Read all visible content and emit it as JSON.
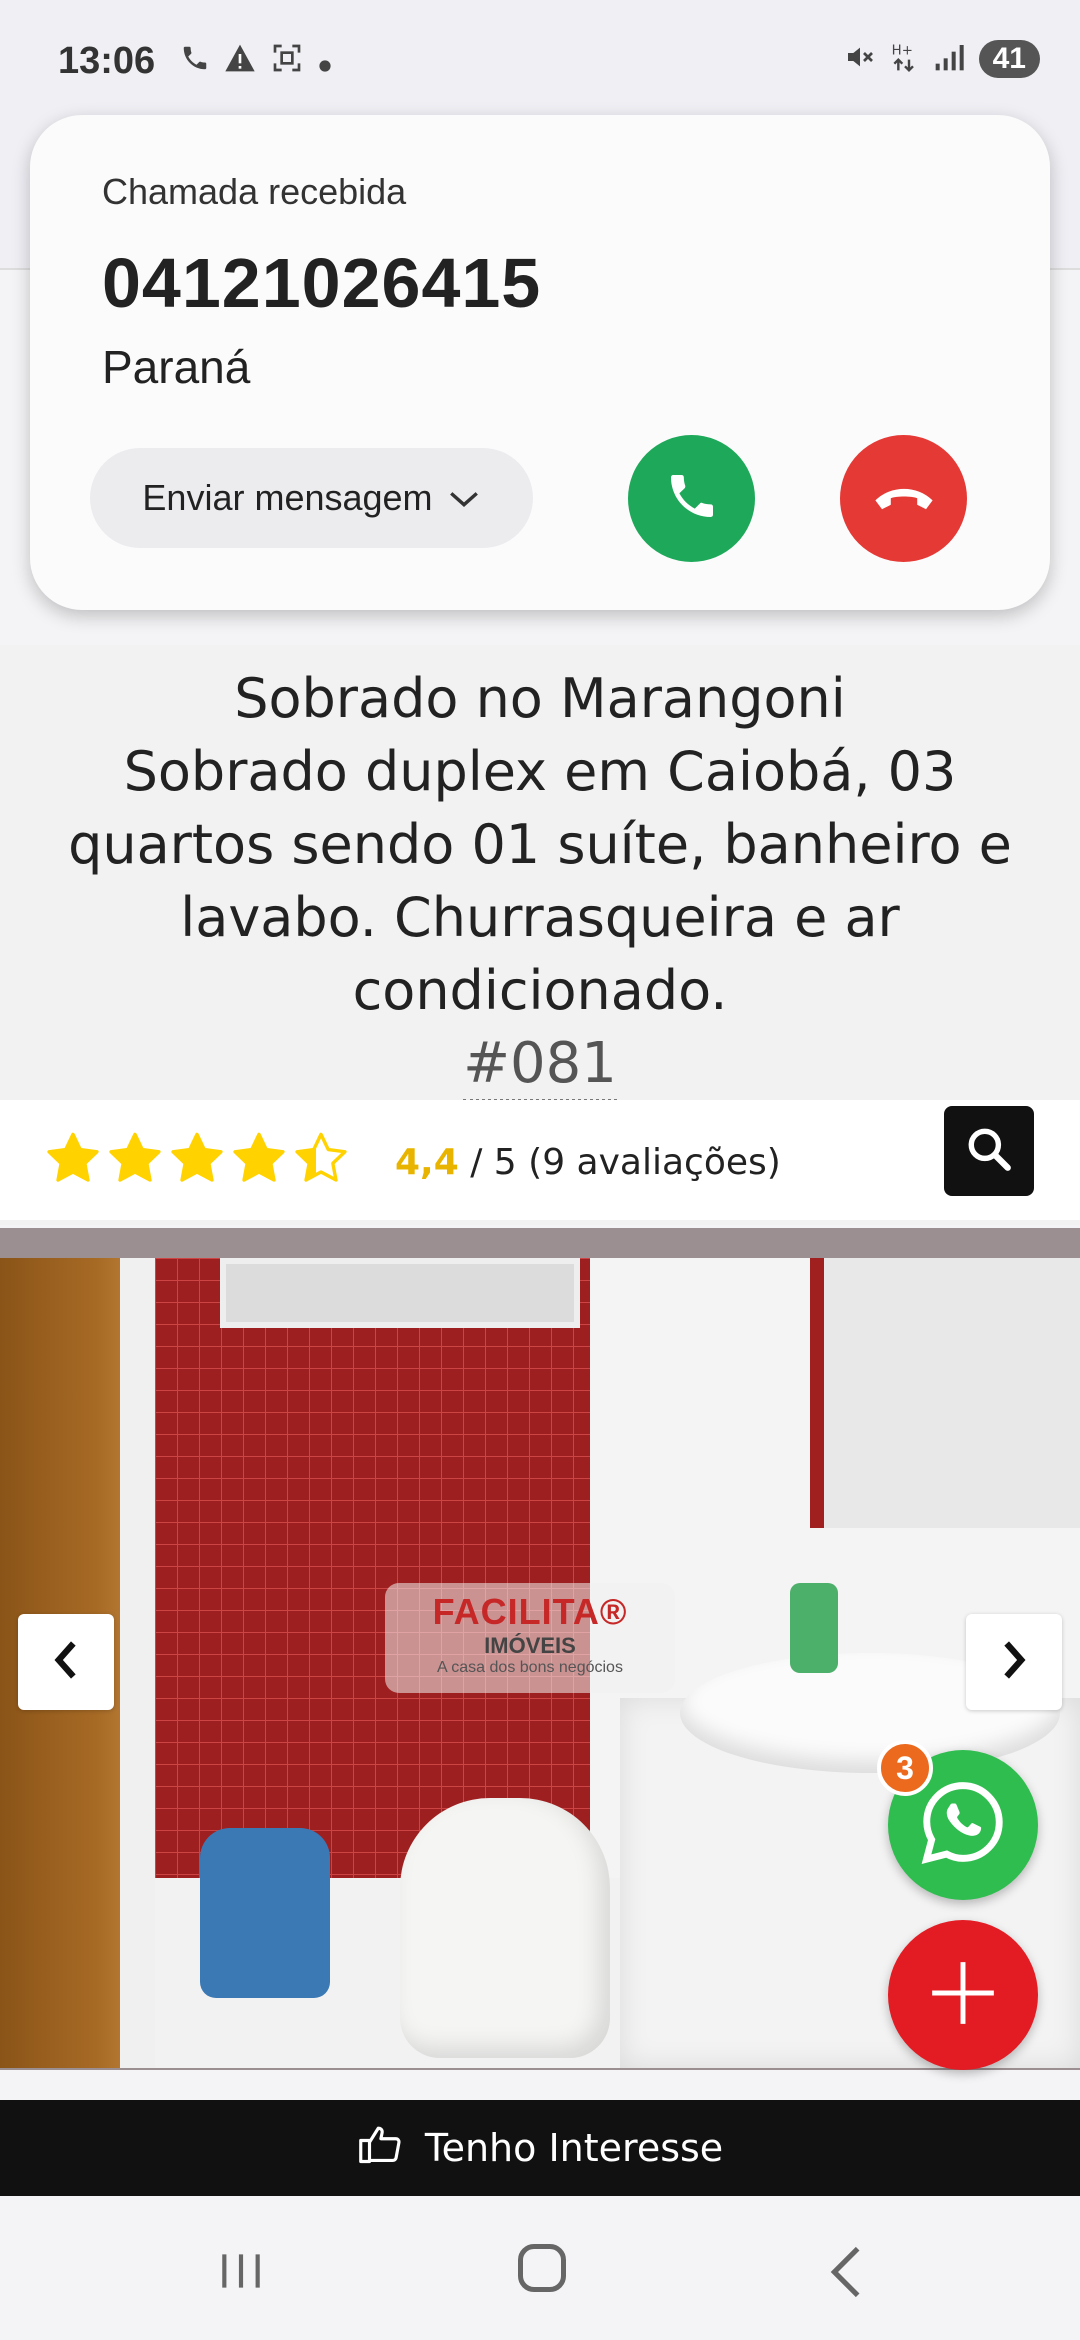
{
  "status_bar": {
    "time": "13:06",
    "battery": "41",
    "left_icons": [
      "phone-icon",
      "warning-icon",
      "screenshot-icon",
      "dot-icon"
    ],
    "right_icons": [
      "mute-icon",
      "data-icon",
      "signal-icon"
    ]
  },
  "incoming_call": {
    "label": "Chamada recebida",
    "number": "04121026415",
    "region": "Paraná",
    "message_button": "Enviar mensagem",
    "accept_color": "#1ea95a",
    "decline_color": "#e53935"
  },
  "listing": {
    "title": "Sobrado no Marangoni",
    "description": "Sobrado duplex em Caiobá, 03 quartos sendo 01 suíte, banheiro e lavabo. Churrasqueira e ar condicionado.",
    "code": "#081"
  },
  "rating": {
    "value": "4,4",
    "suffix": " / 5 (9 avaliações)",
    "stars_filled": 4.4,
    "stars_total": 5,
    "star_color": "#ffd200"
  },
  "gallery": {
    "watermark_brand": "FACILITA®",
    "watermark_sub": "IMÓVEIS",
    "watermark_tag": "A casa dos bons negócios"
  },
  "floating": {
    "whatsapp_badge": "3"
  },
  "cta": {
    "label": "Tenho Interesse"
  }
}
